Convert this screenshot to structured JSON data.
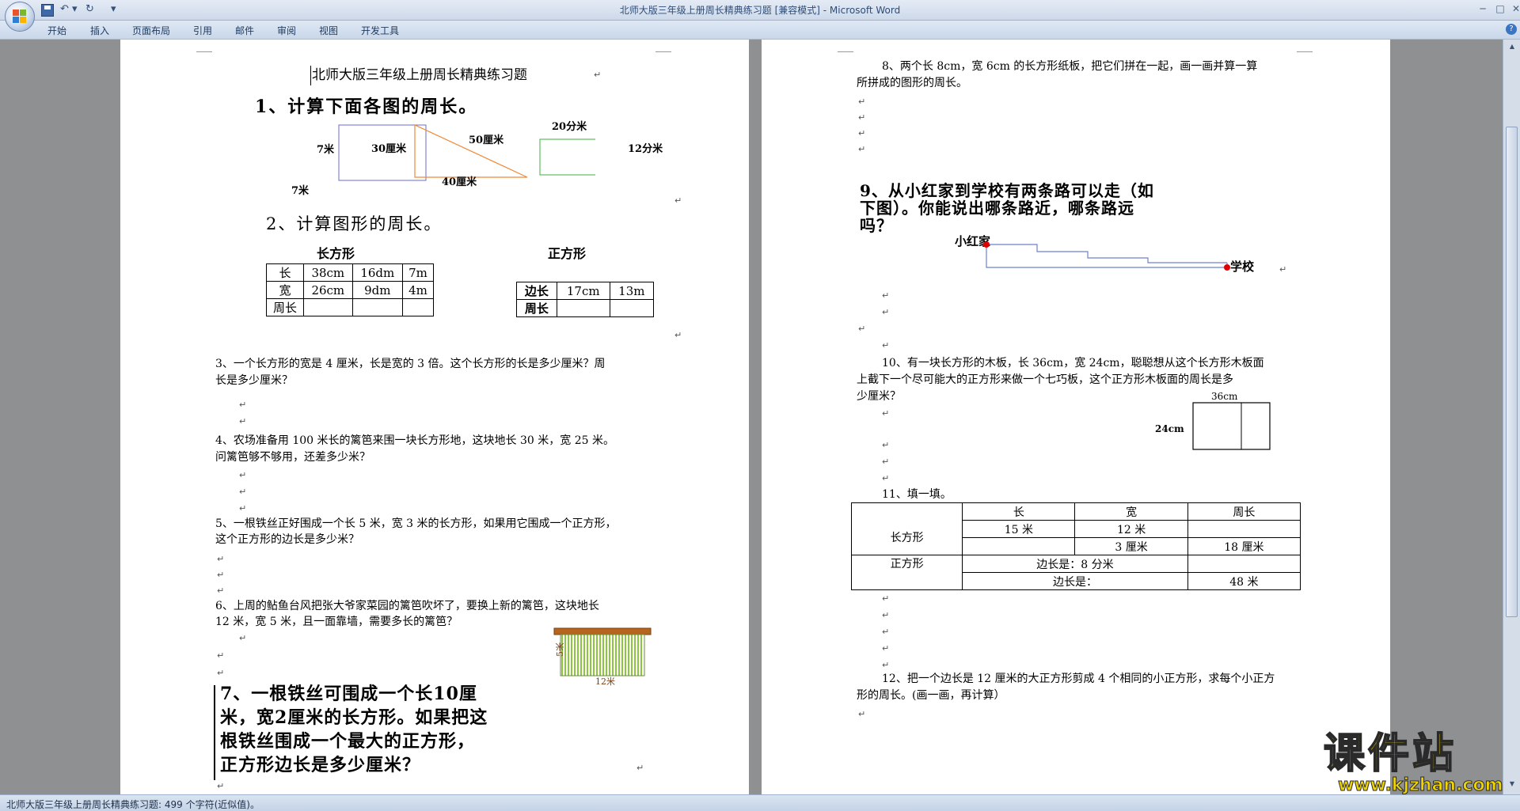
{
  "window": {
    "title": "北师大版三年级上册周长精典练习题 [兼容模式] - ",
    "app": "Microsoft Word",
    "min": "─",
    "max": "□",
    "close": "✕"
  },
  "qat": {
    "undo": "↶ ▾",
    "redo": "↻",
    "menu": "▾"
  },
  "ribbon_tabs": [
    "开始",
    "插入",
    "页面布局",
    "引用",
    "邮件",
    "审阅",
    "视图",
    "开发工具"
  ],
  "help": "?",
  "page1": {
    "doc_title": "北师大版三年级上册周长精典练习题",
    "q1_heading": "1、计算下面各图的周长。",
    "q1_labels": {
      "rect_left": "7米",
      "rect_bottom": "7米",
      "tri_left": "30厘米",
      "tri_hyp": "50厘米",
      "tri_bottom": "40厘米",
      "rect2_top": "20分米",
      "rect2_right": "12分米"
    },
    "q2_heading": "2、计算图形的周长。",
    "q2_rect_title": "长方形",
    "q2_square_title": "正方形",
    "rect_table": [
      [
        "长",
        "38cm",
        "16dm",
        "7m"
      ],
      [
        "宽",
        "26cm",
        "9dm",
        "4m"
      ],
      [
        "周长",
        "",
        "",
        ""
      ]
    ],
    "square_table": [
      [
        "边长",
        "17cm",
        "13m"
      ],
      [
        "周长",
        "",
        ""
      ]
    ],
    "q3": [
      "3、一个长方形的宽是 4 厘米，长是宽的 3 倍。这个长方形的长是多少厘米？周",
      "长是多少厘米？"
    ],
    "q4": [
      "4、农场准备用 100 米长的篱笆来围一块长方形地，这块地长 30 米，宽 25 米。",
      "问篱笆够不够用，还差多少米？"
    ],
    "q5": [
      "5、一根铁丝正好围成一个长 5 米，宽 3 米的长方形，如果用它围成一个正方形，",
      "这个正方形的边长是多少米？"
    ],
    "q6": [
      "6、上周的鲇鱼台风把张大爷家菜园的篱笆吹坏了，要换上新的篱笆，这块地长",
      "12 米，宽 5 米，且一面靠墙，需要多长的篱笆？"
    ],
    "q6_fig": {
      "side": "5米",
      "bottom": "12米"
    },
    "q7": [
      "7、一根铁丝可围成一个长10厘",
      "米，宽2厘米的长方形。如果把这",
      "根铁丝围成一个最大的正方形，",
      "正方形边长是多少厘米？"
    ]
  },
  "page2": {
    "q8": [
      "8、两个长 8cm，宽 6cm 的长方形纸板，把它们拼在一起，画一画并算一算",
      "所拼成的图形的周长。"
    ],
    "q9": [
      "9、从小红家到学校有两条路可以走（如",
      "下图）。你能说出哪条路近，哪条路远",
      "吗？"
    ],
    "q9_fig": {
      "home": "小红家",
      "school": "学校"
    },
    "q10": [
      "10、有一块长方形的木板，长 36cm，宽 24cm，聪聪想从这个长方形木板面",
      "上截下一个尽可能大的正方形来做一个七巧板，这个正方形木板面的周长是多",
      "少厘米？"
    ],
    "q10_fig": {
      "top": "36cm",
      "left": "24cm"
    },
    "q11_heading": "11、填一填。",
    "q11_header": [
      "",
      "长",
      "宽",
      "周长"
    ],
    "q11_rect_label": "长方形",
    "q11_rect_rows": [
      [
        "15 米",
        "12 米",
        ""
      ],
      [
        "",
        "3 厘米",
        "18 厘米"
      ]
    ],
    "q11_square_label": "正方形",
    "q11_square_rows": [
      [
        "边长是：8 分米",
        ""
      ],
      [
        "边长是：",
        "48 米"
      ]
    ],
    "q12": [
      "12、把一个边长是 12 厘米的大正方形剪成 4 个相同的小正方形，求每个小正方",
      "形的周长。(画一画，再计算）"
    ]
  },
  "status": {
    "text": "北师大版三年级上册周长精典练习题: 499 个字符(近似值)。"
  },
  "watermark": {
    "big": "课件站",
    "url": "www.kjzhan.com"
  },
  "colors": {
    "rect1": "#6b6bd6",
    "triangle": "#f08a3a",
    "rect2": "#3cb043",
    "route": "#6e7fd0",
    "route_dot": "#e00000",
    "fence": "#8cc63f"
  }
}
